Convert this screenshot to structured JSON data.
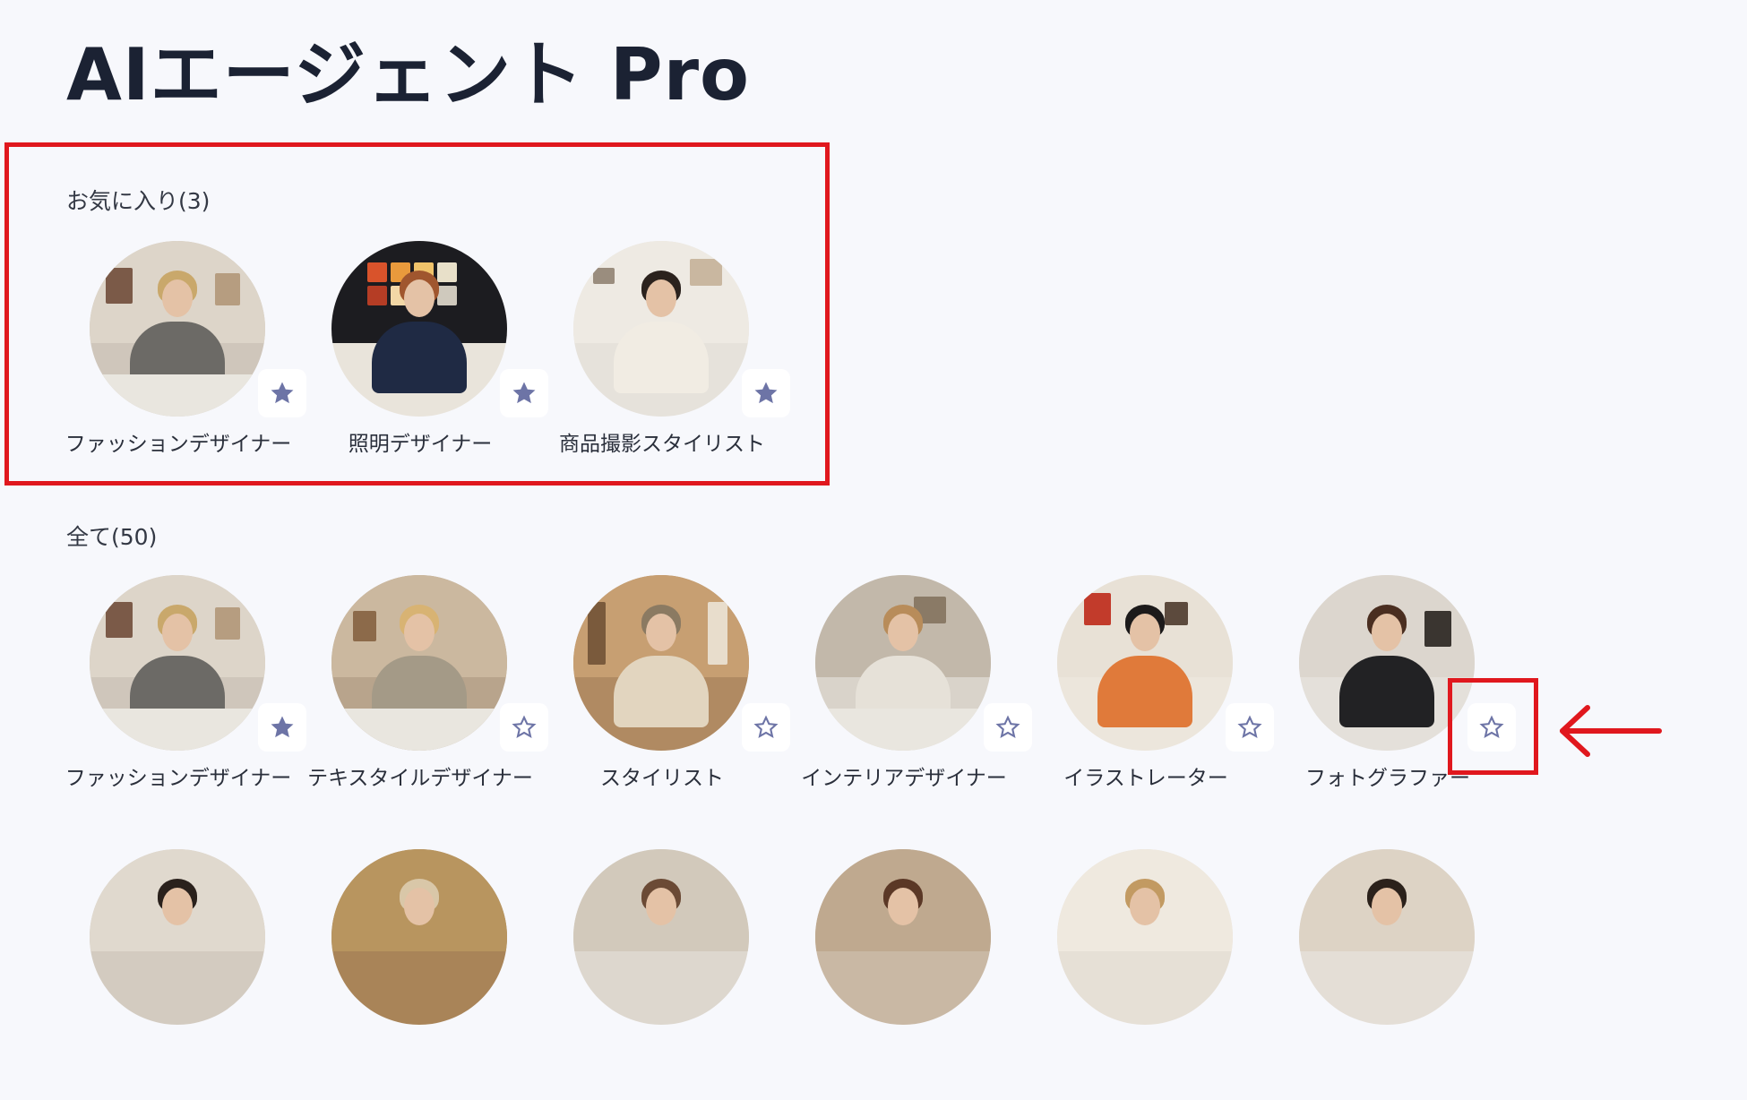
{
  "page_title": "AIエージェント Pro",
  "favorites": {
    "label": "お気に入り(3)",
    "items": [
      {
        "name": "ファッションデザイナー",
        "favorite": true
      },
      {
        "name": "照明デザイナー",
        "favorite": true
      },
      {
        "name": "商品撮影スタイリスト",
        "favorite": true
      }
    ]
  },
  "all": {
    "label": "全て(50)",
    "items": [
      {
        "name": "ファッションデザイナー",
        "favorite": true
      },
      {
        "name": "テキスタイルデザイナー",
        "favorite": false
      },
      {
        "name": "スタイリスト",
        "favorite": false
      },
      {
        "name": "インテリアデザイナー",
        "favorite": false
      },
      {
        "name": "イラストレーター",
        "favorite": false
      },
      {
        "name": "フォトグラファー",
        "favorite": false
      }
    ]
  },
  "icons": {
    "favorite_on": "star-filled-icon",
    "favorite_off": "star-outline-icon",
    "annotation_arrow": "arrow-left-icon"
  },
  "colors": {
    "background": "#f7f8fc",
    "star": "#6d74a6",
    "annotation": "#e0181e"
  }
}
